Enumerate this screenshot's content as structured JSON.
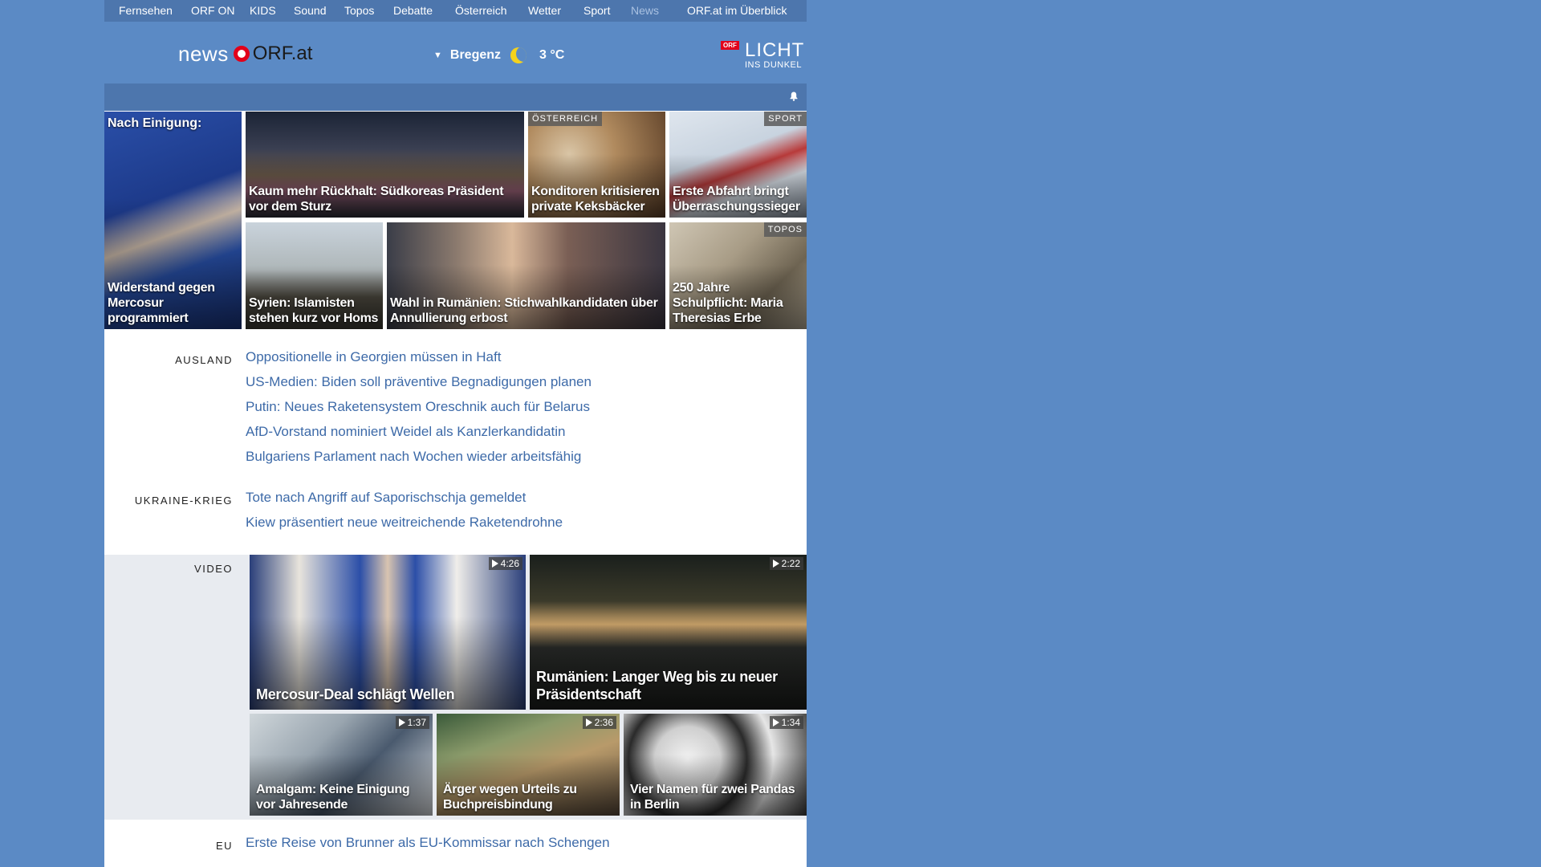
{
  "topnav": {
    "items": [
      "Fernsehen",
      "ORF ON",
      "KIDS",
      "Sound",
      "Topos",
      "Debatte",
      "Österreich",
      "Wetter",
      "Sport",
      "News",
      "ORF.at im Überblick"
    ]
  },
  "header": {
    "logo_news": "news",
    "logo_orf": "ORF.at",
    "location": "Bregenz",
    "temperature": "3 °C",
    "licht_tag": "ORF",
    "licht_big": "LICHT",
    "licht_small": "INS DUNKEL"
  },
  "tiles": {
    "t1": {
      "top": "Nach Einigung:",
      "caption": "Widerstand gegen Mercosur programmiert"
    },
    "t2": {
      "caption": "Kaum mehr Rückhalt: Südkoreas Präsident vor dem Sturz"
    },
    "t3": {
      "tag": "ÖSTERREICH",
      "caption": "Konditoren kritisieren private Keksbäcker"
    },
    "t4": {
      "tag": "SPORT",
      "caption": "Erste Abfahrt bringt Überraschungssieger"
    },
    "t5": {
      "caption": "Syrien: Islamisten stehen kurz vor Homs"
    },
    "t6": {
      "caption": "Wahl in Rumänien: Stichwahlkandidaten über Annullierung erbost"
    },
    "t7": {
      "tag": "TOPOS",
      "caption": "250 Jahre Schulpflicht: Maria Theresias Erbe"
    }
  },
  "sections": {
    "ausland": {
      "label": "AUSLAND",
      "links": [
        "Oppositionelle in Georgien müssen in Haft",
        "US-Medien: Biden soll präventive Begnadigungen planen",
        "Putin: Neues Raketensystem Oreschnik auch für Belarus",
        "AfD-Vorstand nominiert Weidel als Kanzlerkandidatin",
        "Bulgariens Parlament nach Wochen wieder arbeitsfähig"
      ]
    },
    "ukraine": {
      "label": "UKRAINE-KRIEG",
      "links": [
        "Tote nach Angriff auf Saporischschja gemeldet",
        "Kiew präsentiert neue weitreichende Raketendrohne"
      ]
    },
    "video": {
      "label": "VIDEO",
      "items": [
        {
          "duration": "4:26",
          "caption": "Mercosur-Deal schlägt Wellen"
        },
        {
          "duration": "2:22",
          "caption": "Rumänien: Langer Weg bis zu neuer Präsidentschaft"
        },
        {
          "duration": "1:37",
          "caption": "Amalgam: Keine Einigung vor Jahresende"
        },
        {
          "duration": "2:36",
          "caption": "Ärger wegen Urteils zu Buchpreisbindung"
        },
        {
          "duration": "1:34",
          "caption": "Vier Namen für zwei Pandas in Berlin"
        }
      ]
    },
    "eu": {
      "label": "EU",
      "links": [
        "Erste Reise von Brunner als EU-Kommissar nach Schengen"
      ]
    }
  },
  "colors": {
    "background": "#5b8ac5",
    "nav": "#4d76ad",
    "link": "#3d6aa8",
    "orf_red": "#e2001a"
  }
}
